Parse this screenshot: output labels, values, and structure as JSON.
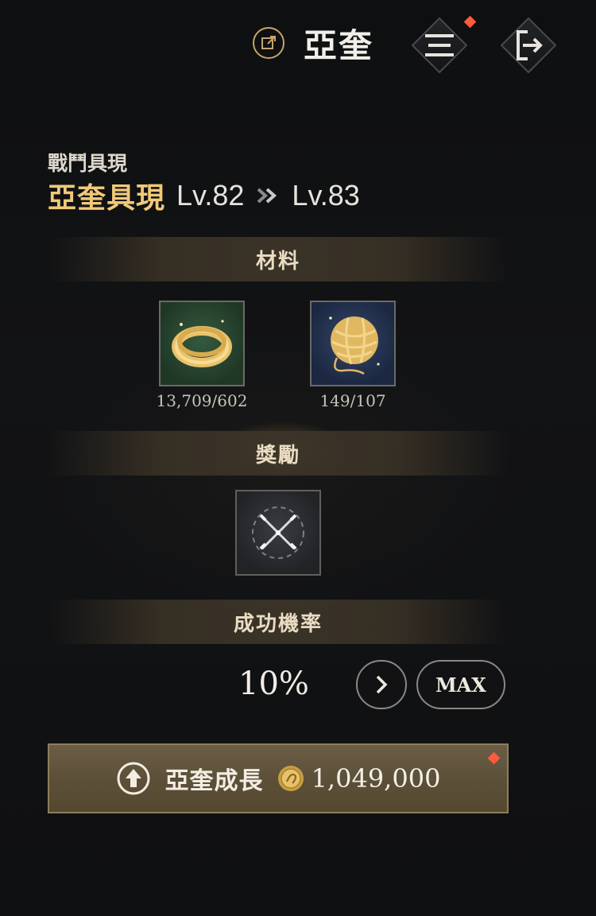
{
  "header": {
    "title": "亞奎",
    "link_icon": "external-link-icon",
    "menu_icon": "menu-icon",
    "exit_icon": "exit-icon",
    "accent": "#c7a56a",
    "notification_color": "#ff5a3a"
  },
  "spirit": {
    "category": "戰鬥具現",
    "name": "亞奎具現",
    "current_level": "Lv.82",
    "next_level": "Lv.83",
    "name_color": "#f0c979"
  },
  "materials": {
    "label": "材料",
    "items": [
      {
        "icon": "golden-thread-coil-icon",
        "count": "13,709/602"
      },
      {
        "icon": "golden-yarn-ball-icon",
        "count": "149/107"
      }
    ]
  },
  "rewards": {
    "label": "獎勵",
    "items": [
      {
        "icon": "crossed-swords-icon"
      }
    ]
  },
  "success_rate": {
    "label": "成功機率",
    "value": "10%",
    "next_icon": "chevron-right-icon",
    "max_label": "MAX"
  },
  "grow_button": {
    "icon": "upgrade-arrow-icon",
    "label": "亞奎成長",
    "coin_icon": "gold-coin-icon",
    "cost": "1,049,000"
  }
}
